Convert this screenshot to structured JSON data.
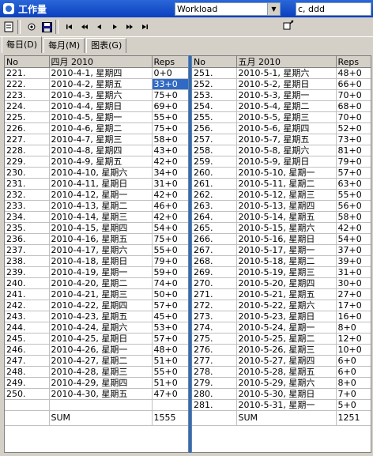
{
  "window": {
    "title": "工作量"
  },
  "toolbar": {
    "icons": [
      "page-icon",
      "view-icon",
      "save-icon",
      "first-icon",
      "prev-page-icon",
      "prev-icon",
      "next-icon",
      "next-page-icon",
      "last-icon"
    ],
    "workload_combo": "Workload",
    "search_combo": "c, ddd"
  },
  "tabs": [
    {
      "label": "每日(D)",
      "active": true
    },
    {
      "label": "每月(M)",
      "active": false
    },
    {
      "label": "图表(G)",
      "active": false
    }
  ],
  "april": {
    "headers": {
      "no": "No",
      "date": "四月 2010",
      "reps": "Reps"
    },
    "rows": [
      {
        "no": "221.",
        "date": "2010-4-1, 星期四",
        "reps": "0+0"
      },
      {
        "no": "222.",
        "date": "2010-4-2, 星期五",
        "reps": "33+0",
        "selected": true
      },
      {
        "no": "223.",
        "date": "2010-4-3, 星期六",
        "reps": "75+0"
      },
      {
        "no": "224.",
        "date": "2010-4-4, 星期日",
        "reps": "69+0"
      },
      {
        "no": "225.",
        "date": "2010-4-5, 星期一",
        "reps": "55+0"
      },
      {
        "no": "226.",
        "date": "2010-4-6, 星期二",
        "reps": "75+0"
      },
      {
        "no": "227.",
        "date": "2010-4-7, 星期三",
        "reps": "58+0"
      },
      {
        "no": "228.",
        "date": "2010-4-8, 星期四",
        "reps": "43+0"
      },
      {
        "no": "229.",
        "date": "2010-4-9, 星期五",
        "reps": "42+0"
      },
      {
        "no": "230.",
        "date": "2010-4-10, 星期六",
        "reps": "34+0"
      },
      {
        "no": "231.",
        "date": "2010-4-11, 星期日",
        "reps": "31+0"
      },
      {
        "no": "232.",
        "date": "2010-4-12, 星期一",
        "reps": "42+0"
      },
      {
        "no": "233.",
        "date": "2010-4-13, 星期二",
        "reps": "46+0"
      },
      {
        "no": "234.",
        "date": "2010-4-14, 星期三",
        "reps": "42+0"
      },
      {
        "no": "235.",
        "date": "2010-4-15, 星期四",
        "reps": "54+0"
      },
      {
        "no": "236.",
        "date": "2010-4-16, 星期五",
        "reps": "75+0"
      },
      {
        "no": "237.",
        "date": "2010-4-17, 星期六",
        "reps": "55+0"
      },
      {
        "no": "238.",
        "date": "2010-4-18, 星期日",
        "reps": "79+0"
      },
      {
        "no": "239.",
        "date": "2010-4-19, 星期一",
        "reps": "59+0"
      },
      {
        "no": "240.",
        "date": "2010-4-20, 星期二",
        "reps": "74+0"
      },
      {
        "no": "241.",
        "date": "2010-4-21, 星期三",
        "reps": "50+0"
      },
      {
        "no": "242.",
        "date": "2010-4-22, 星期四",
        "reps": "57+0"
      },
      {
        "no": "243.",
        "date": "2010-4-23, 星期五",
        "reps": "45+0"
      },
      {
        "no": "244.",
        "date": "2010-4-24, 星期六",
        "reps": "53+0"
      },
      {
        "no": "245.",
        "date": "2010-4-25, 星期日",
        "reps": "57+0"
      },
      {
        "no": "246.",
        "date": "2010-4-26, 星期一",
        "reps": "48+0"
      },
      {
        "no": "247.",
        "date": "2010-4-27, 星期二",
        "reps": "51+0"
      },
      {
        "no": "248.",
        "date": "2010-4-28, 星期三",
        "reps": "55+0"
      },
      {
        "no": "249.",
        "date": "2010-4-29, 星期四",
        "reps": "51+0"
      },
      {
        "no": "250.",
        "date": "2010-4-30, 星期五",
        "reps": "47+0"
      },
      {
        "no": "",
        "date": "",
        "reps": ""
      }
    ],
    "sum": {
      "label": "SUM",
      "value": "1555"
    }
  },
  "may": {
    "headers": {
      "no": "No",
      "date": "五月 2010",
      "reps": "Reps"
    },
    "rows": [
      {
        "no": "251.",
        "date": "2010-5-1, 星期六",
        "reps": "48+0"
      },
      {
        "no": "252.",
        "date": "2010-5-2, 星期日",
        "reps": "66+0"
      },
      {
        "no": "253.",
        "date": "2010-5-3, 星期一",
        "reps": "70+0"
      },
      {
        "no": "254.",
        "date": "2010-5-4, 星期二",
        "reps": "68+0"
      },
      {
        "no": "255.",
        "date": "2010-5-5, 星期三",
        "reps": "70+0"
      },
      {
        "no": "256.",
        "date": "2010-5-6, 星期四",
        "reps": "52+0"
      },
      {
        "no": "257.",
        "date": "2010-5-7, 星期五",
        "reps": "73+0"
      },
      {
        "no": "258.",
        "date": "2010-5-8, 星期六",
        "reps": "81+0"
      },
      {
        "no": "259.",
        "date": "2010-5-9, 星期日",
        "reps": "79+0"
      },
      {
        "no": "260.",
        "date": "2010-5-10, 星期一",
        "reps": "57+0"
      },
      {
        "no": "261.",
        "date": "2010-5-11, 星期二",
        "reps": "63+0"
      },
      {
        "no": "262.",
        "date": "2010-5-12, 星期三",
        "reps": "55+0"
      },
      {
        "no": "263.",
        "date": "2010-5-13, 星期四",
        "reps": "56+0"
      },
      {
        "no": "264.",
        "date": "2010-5-14, 星期五",
        "reps": "58+0"
      },
      {
        "no": "265.",
        "date": "2010-5-15, 星期六",
        "reps": "42+0"
      },
      {
        "no": "266.",
        "date": "2010-5-16, 星期日",
        "reps": "54+0"
      },
      {
        "no": "267.",
        "date": "2010-5-17, 星期一",
        "reps": "37+0"
      },
      {
        "no": "268.",
        "date": "2010-5-18, 星期二",
        "reps": "39+0"
      },
      {
        "no": "269.",
        "date": "2010-5-19, 星期三",
        "reps": "31+0"
      },
      {
        "no": "270.",
        "date": "2010-5-20, 星期四",
        "reps": "30+0"
      },
      {
        "no": "271.",
        "date": "2010-5-21, 星期五",
        "reps": "27+0"
      },
      {
        "no": "272.",
        "date": "2010-5-22, 星期六",
        "reps": "17+0"
      },
      {
        "no": "273.",
        "date": "2010-5-23, 星期日",
        "reps": "16+0"
      },
      {
        "no": "274.",
        "date": "2010-5-24, 星期一",
        "reps": "8+0"
      },
      {
        "no": "275.",
        "date": "2010-5-25, 星期二",
        "reps": "12+0"
      },
      {
        "no": "276.",
        "date": "2010-5-26, 星期三",
        "reps": "10+0"
      },
      {
        "no": "277.",
        "date": "2010-5-27, 星期四",
        "reps": "6+0"
      },
      {
        "no": "278.",
        "date": "2010-5-28, 星期五",
        "reps": "6+0"
      },
      {
        "no": "279.",
        "date": "2010-5-29, 星期六",
        "reps": "8+0"
      },
      {
        "no": "280.",
        "date": "2010-5-30, 星期日",
        "reps": "7+0"
      },
      {
        "no": "281.",
        "date": "2010-5-31, 星期一",
        "reps": "5+0"
      }
    ],
    "sum": {
      "label": "SUM",
      "value": "1251"
    }
  },
  "colors": {
    "title_bar": "#0a3fbf",
    "selection": "#316ac5",
    "divider": "#1f6fd0"
  }
}
